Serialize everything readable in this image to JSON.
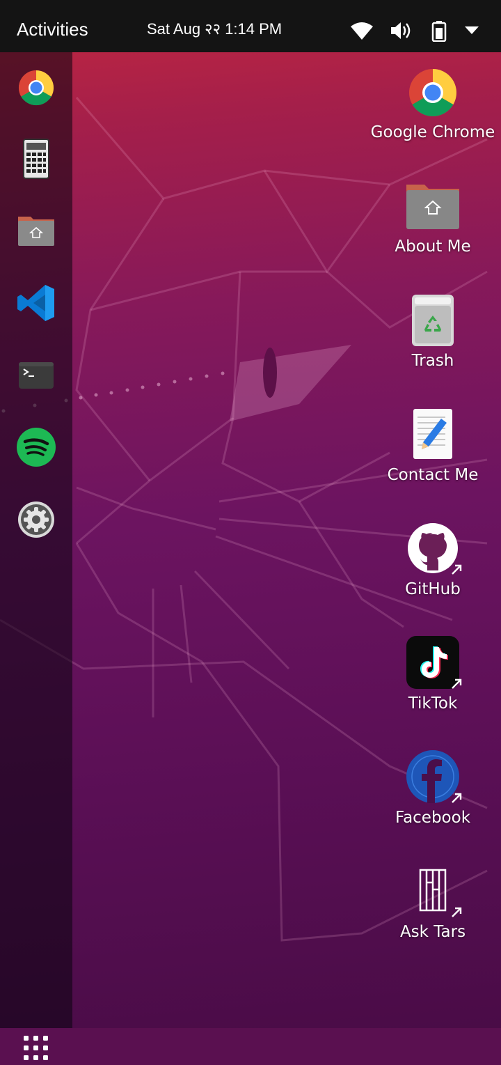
{
  "topbar": {
    "activities_label": "Activities",
    "clock": "Sat Aug २२ 1:14 PM",
    "tray_icons": [
      "wifi-icon",
      "volume-icon",
      "battery-icon",
      "system-menu-chevron-icon"
    ]
  },
  "dock": {
    "items": [
      {
        "name": "Google Chrome",
        "icon": "chrome-icon"
      },
      {
        "name": "Calculator",
        "icon": "calculator-icon"
      },
      {
        "name": "Files",
        "icon": "home-folder-icon"
      },
      {
        "name": "Visual Studio Code",
        "icon": "vscode-icon"
      },
      {
        "name": "Terminal",
        "icon": "terminal-icon"
      },
      {
        "name": "Spotify",
        "icon": "spotify-icon"
      },
      {
        "name": "Settings",
        "icon": "settings-gear-icon"
      }
    ],
    "show_apps_icon": "apps-grid-icon"
  },
  "desktop": {
    "icons": [
      {
        "label": "Google Chrome",
        "icon": "chrome-icon"
      },
      {
        "label": "About Me",
        "icon": "home-folder-icon"
      },
      {
        "label": "Trash",
        "icon": "trash-icon"
      },
      {
        "label": "Contact Me",
        "icon": "text-editor-icon"
      },
      {
        "label": "GitHub",
        "icon": "github-icon",
        "shortcut": true
      },
      {
        "label": "TikTok",
        "icon": "tiktok-icon",
        "shortcut": true
      },
      {
        "label": "Facebook",
        "icon": "facebook-icon",
        "shortcut": true
      },
      {
        "label": "Ask Tars",
        "icon": "tars-icon",
        "shortcut": true
      }
    ]
  },
  "colors": {
    "topbar": "#141414",
    "wallpaper_top": "#c4283f",
    "wallpaper_bottom": "#4a0c47",
    "dock_bg": "rgba(10,4,14,0.55)"
  }
}
